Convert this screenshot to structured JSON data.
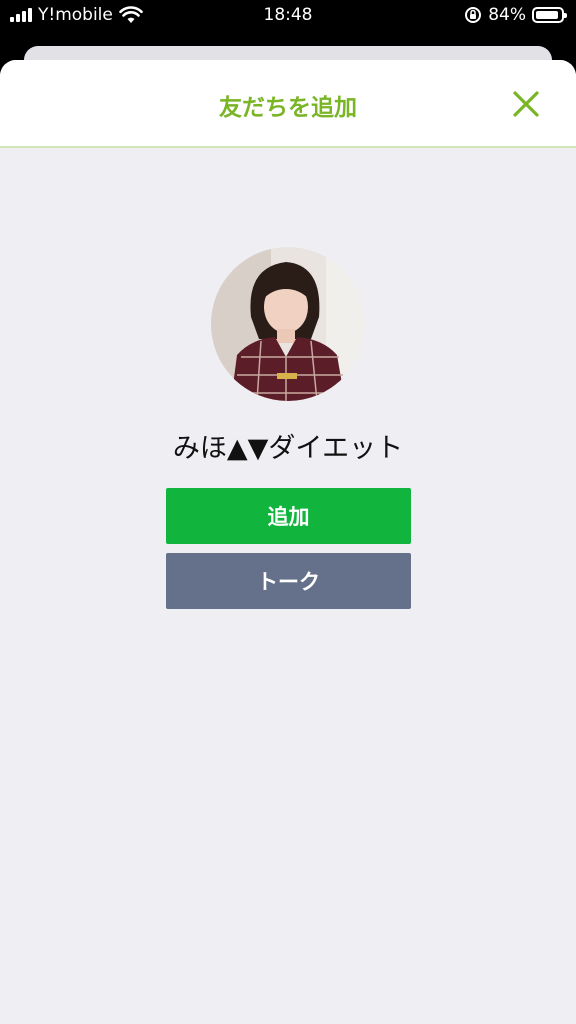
{
  "status_bar": {
    "carrier": "Y!mobile",
    "time": "18:48",
    "battery_percent": "84%",
    "battery_level": 0.84
  },
  "modal": {
    "title": "友だちを追加",
    "accent_color": "#7ab526"
  },
  "profile": {
    "name": "みほ▲▼ダイエット"
  },
  "actions": {
    "add_label": "追加",
    "add_color": "#11b43c",
    "talk_label": "トーク",
    "talk_color": "#65718b"
  }
}
